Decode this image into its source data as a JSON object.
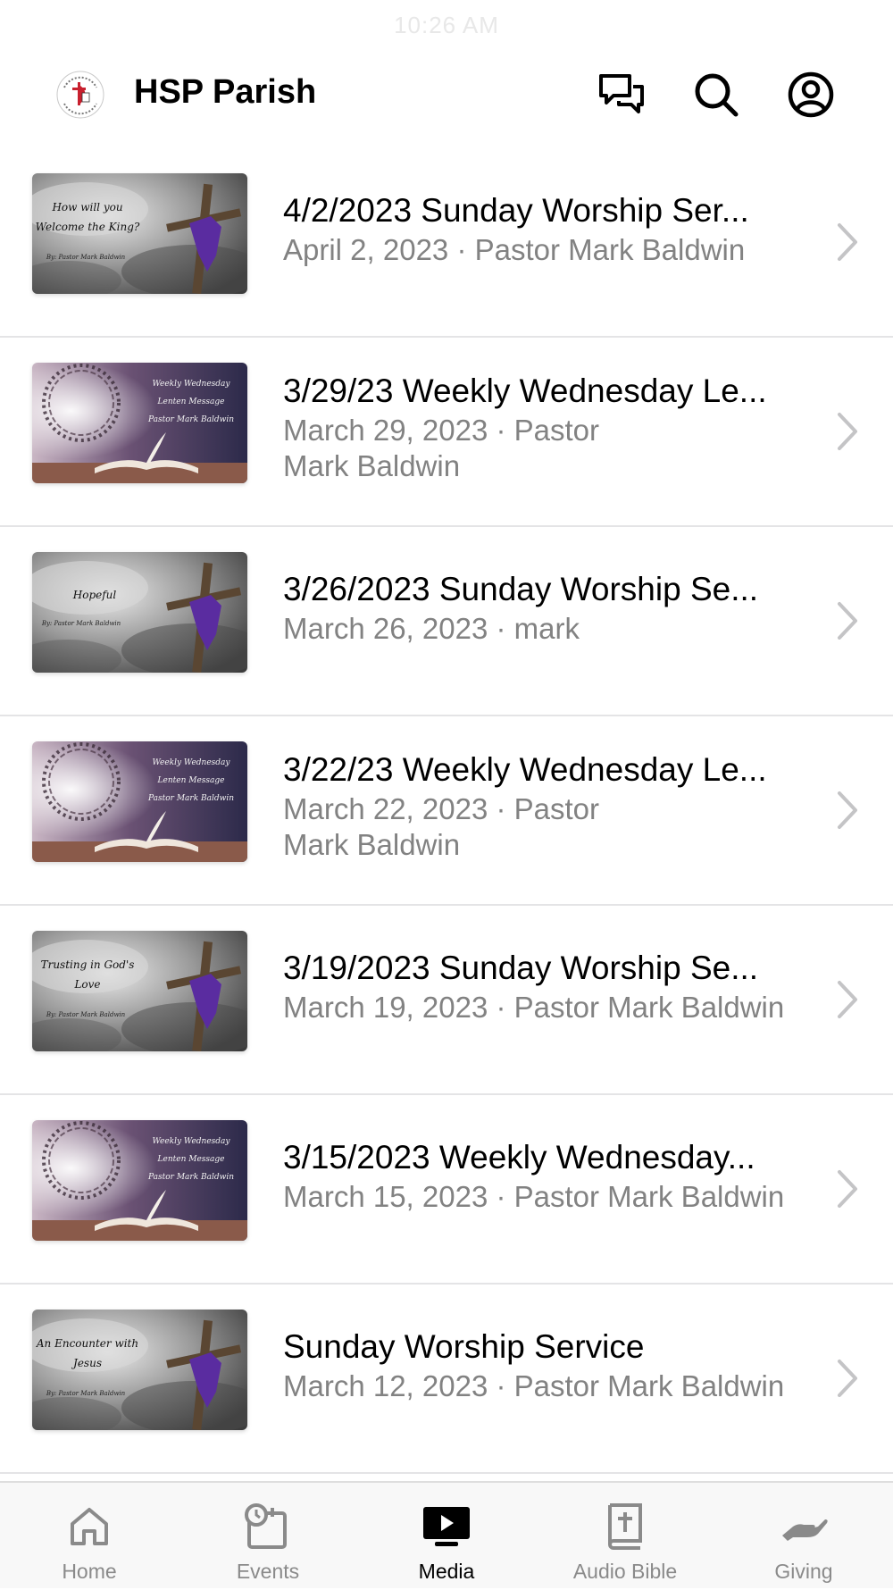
{
  "status_bar": {
    "time": "10:26 AM"
  },
  "header": {
    "title": "HSP Parish",
    "logo_icon": "parish-logo-icon",
    "actions": [
      {
        "name": "chat-button",
        "icon": "chat-bubbles-icon"
      },
      {
        "name": "search-button",
        "icon": "search-icon"
      },
      {
        "name": "account-button",
        "icon": "account-circle-icon"
      }
    ]
  },
  "media_list": [
    {
      "title": "4/2/2023 Sunday Worship Ser...",
      "subtitle": "April 2, 2023 · Pastor Mark Baldwin",
      "thumbnail": {
        "style": "cross",
        "text_lines": [
          "How will you",
          "Welcome the King?"
        ],
        "byline": "By: Pastor Mark Baldwin"
      }
    },
    {
      "title": "3/29/23 Weekly Wednesday Le...",
      "subtitle": "March 29, 2023 · Pastor Mark Baldwin",
      "thumbnail": {
        "style": "lenten",
        "text_lines": [
          "Weekly Wednesday",
          "Lenten Message",
          "Pastor Mark Baldwin"
        ],
        "byline": ""
      }
    },
    {
      "title": "3/26/2023 Sunday Worship Se...",
      "subtitle": "March 26, 2023 · mark",
      "thumbnail": {
        "style": "cross",
        "text_lines": [
          "Hopeful"
        ],
        "byline": "By: Pastor Mark Baldwin"
      }
    },
    {
      "title": "3/22/23 Weekly Wednesday Le...",
      "subtitle": "March 22, 2023 · Pastor Mark Baldwin",
      "thumbnail": {
        "style": "lenten",
        "text_lines": [
          "Weekly Wednesday",
          "Lenten Message",
          "Pastor Mark Baldwin"
        ],
        "byline": ""
      }
    },
    {
      "title": "3/19/2023 Sunday Worship Se...",
      "subtitle": "March 19, 2023 · Pastor Mark Baldwin",
      "thumbnail": {
        "style": "cross",
        "text_lines": [
          "Trusting in God's",
          "Love"
        ],
        "byline": "By: Pastor Mark Baldwin"
      }
    },
    {
      "title": "3/15/2023 Weekly Wednesday...",
      "subtitle": "March 15, 2023 · Pastor Mark Baldwin",
      "thumbnail": {
        "style": "lenten",
        "text_lines": [
          "Weekly Wednesday",
          "Lenten Message",
          "Pastor Mark Baldwin"
        ],
        "byline": ""
      }
    },
    {
      "title": "Sunday Worship Service",
      "subtitle": "March 12, 2023 · Pastor Mark Baldwin",
      "thumbnail": {
        "style": "cross",
        "text_lines": [
          "An Encounter with",
          "Jesus"
        ],
        "byline": "By: Pastor Mark Baldwin"
      }
    }
  ],
  "tab_bar": {
    "active": "Media",
    "tabs": [
      {
        "label": "Home",
        "icon": "home-icon"
      },
      {
        "label": "Events",
        "icon": "calendar-clock-icon"
      },
      {
        "label": "Media",
        "icon": "play-screen-icon"
      },
      {
        "label": "Audio Bible",
        "icon": "bible-icon"
      },
      {
        "label": "Giving",
        "icon": "giving-hand-icon"
      }
    ]
  },
  "colors": {
    "secondary_text": "#828282",
    "divider": "#e4e4e6",
    "tab_inactive": "#8a8a8a",
    "tab_active": "#000000",
    "sash_purple": "#5a2ca0"
  }
}
